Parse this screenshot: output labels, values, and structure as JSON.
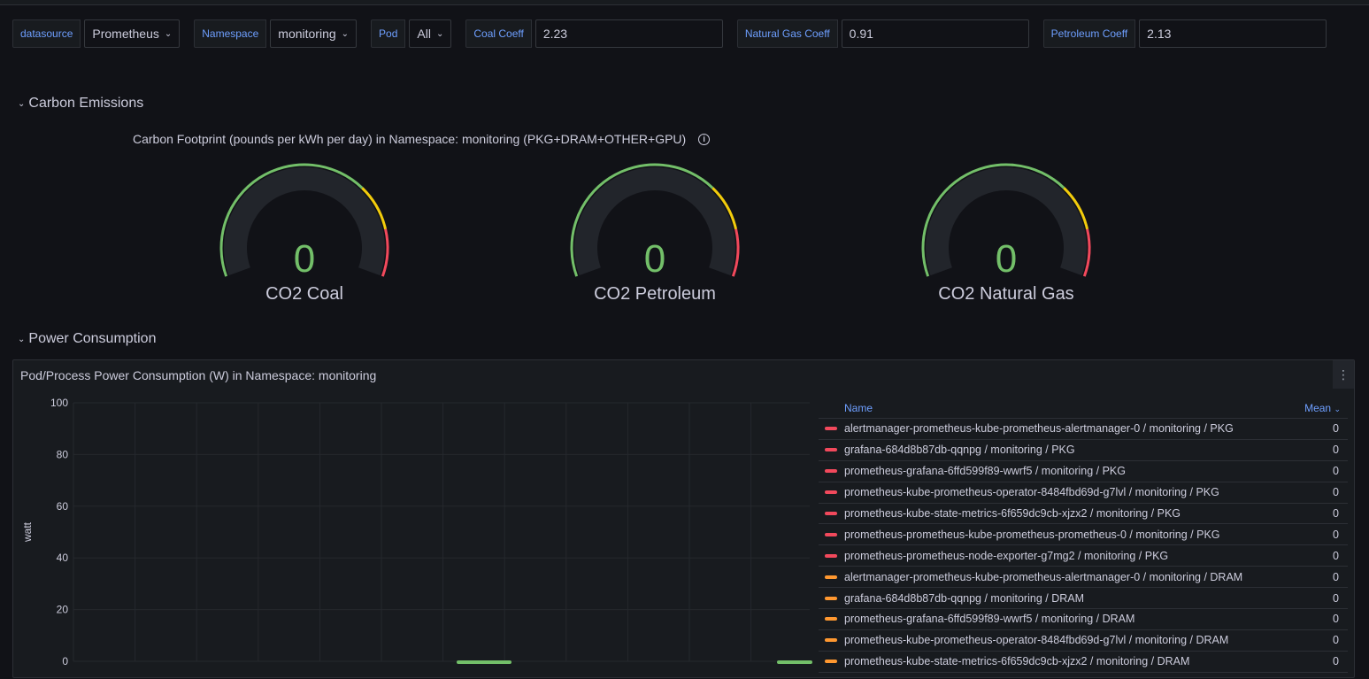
{
  "variables": [
    {
      "label": "datasource",
      "type": "select",
      "value": "Prometheus"
    },
    {
      "label": "Namespace",
      "type": "select",
      "value": "monitoring"
    },
    {
      "label": "Pod",
      "type": "select",
      "value": "All"
    },
    {
      "label": "Coal Coeff",
      "type": "input",
      "value": "2.23"
    },
    {
      "label": "Natural Gas Coeff",
      "type": "input",
      "value": "0.91"
    },
    {
      "label": "Petroleum Coeff",
      "type": "input",
      "value": "2.13"
    }
  ],
  "rows": {
    "carbon": "Carbon Emissions",
    "power": "Power Consumption"
  },
  "gauge_panel": {
    "title": "Carbon Footprint (pounds per kWh per day) in Namespace: monitoring (PKG+DRAM+OTHER+GPU)",
    "colors": {
      "green": "#73bf69",
      "yellow": "#f2cc0c",
      "red": "#f2495c",
      "track": "#22252b"
    },
    "gauges": [
      {
        "label": "CO2 Coal",
        "value": "0",
        "fraction": 0
      },
      {
        "label": "CO2 Petroleum",
        "value": "0",
        "fraction": 0
      },
      {
        "label": "CO2 Natural Gas",
        "value": "0",
        "fraction": 0
      }
    ]
  },
  "power_panel": {
    "title": "Pod/Process Power Consumption (W) in Namespace: monitoring",
    "menu_icon": "vertical-ellipsis",
    "legend": {
      "name_header": "Name",
      "mean_header": "Mean",
      "sort_icon": "chevron-down",
      "rows": [
        {
          "name": "alertmanager-prometheus-kube-prometheus-alertmanager-0 / monitoring / PKG",
          "mean": "0",
          "color": "#f2495c"
        },
        {
          "name": "grafana-684d8b87db-qqnpg / monitoring / PKG",
          "mean": "0",
          "color": "#f2495c"
        },
        {
          "name": "prometheus-grafana-6ffd599f89-wwrf5 / monitoring / PKG",
          "mean": "0",
          "color": "#f2495c"
        },
        {
          "name": "prometheus-kube-prometheus-operator-8484fbd69d-g7lvl / monitoring / PKG",
          "mean": "0",
          "color": "#f2495c"
        },
        {
          "name": "prometheus-kube-state-metrics-6f659dc9cb-xjzx2 / monitoring / PKG",
          "mean": "0",
          "color": "#f2495c"
        },
        {
          "name": "prometheus-prometheus-kube-prometheus-prometheus-0 / monitoring / PKG",
          "mean": "0",
          "color": "#f2495c"
        },
        {
          "name": "prometheus-prometheus-node-exporter-g7mg2 / monitoring / PKG",
          "mean": "0",
          "color": "#f2495c"
        },
        {
          "name": "alertmanager-prometheus-kube-prometheus-alertmanager-0 / monitoring / DRAM",
          "mean": "0",
          "color": "#ff9830"
        },
        {
          "name": "grafana-684d8b87db-qqnpg / monitoring / DRAM",
          "mean": "0",
          "color": "#ff9830"
        },
        {
          "name": "prometheus-grafana-6ffd599f89-wwrf5 / monitoring / DRAM",
          "mean": "0",
          "color": "#ff9830"
        },
        {
          "name": "prometheus-kube-prometheus-operator-8484fbd69d-g7lvl / monitoring / DRAM",
          "mean": "0",
          "color": "#ff9830"
        },
        {
          "name": "prometheus-kube-state-metrics-6f659dc9cb-xjzx2 / monitoring / DRAM",
          "mean": "0",
          "color": "#ff9830"
        }
      ]
    }
  },
  "chart_data": {
    "type": "line",
    "title": "Pod/Process Power Consumption (W) in Namespace: monitoring",
    "ylabel": "watt",
    "xlabel": "",
    "ylim": [
      0,
      100
    ],
    "yticks": [
      "100",
      "80",
      "60",
      "40",
      "20",
      "0"
    ],
    "grid": true,
    "legend_position": "right",
    "series_note": "all series at 0 W in visible range",
    "series_color_hint": "#73bf69"
  }
}
